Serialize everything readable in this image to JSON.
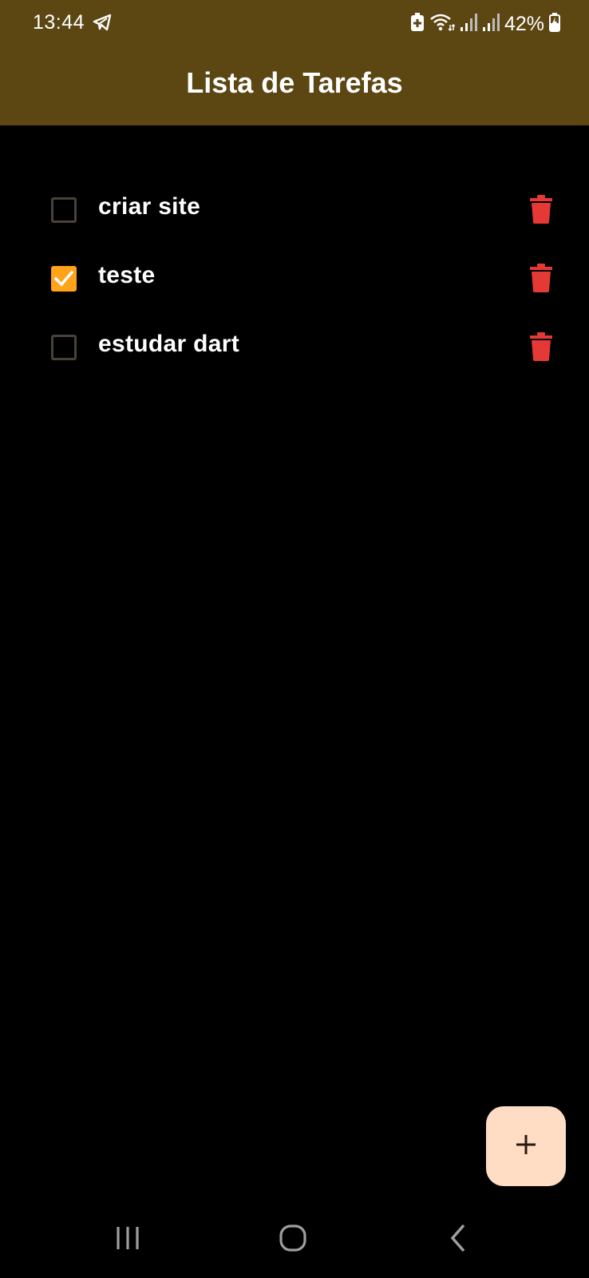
{
  "status_bar": {
    "time": "13:44",
    "battery_percent": "42%",
    "icons": [
      "telegram-icon",
      "battery-saver-icon",
      "wifi-icon",
      "signal-icon",
      "signal-icon",
      "battery-icon"
    ]
  },
  "app_bar": {
    "title": "Lista de Tarefas",
    "background_color": "#5c4713"
  },
  "tasks": [
    {
      "label": "criar site",
      "checked": false
    },
    {
      "label": "teste",
      "checked": true
    },
    {
      "label": "estudar dart",
      "checked": false
    }
  ],
  "colors": {
    "accent": "#ffa319",
    "delete": "#e53935",
    "fab_background": "#ffdcc4"
  },
  "fab": {
    "icon": "plus-icon"
  },
  "nav_bar": {
    "icons": [
      "recent-apps-icon",
      "home-icon",
      "back-icon"
    ]
  }
}
